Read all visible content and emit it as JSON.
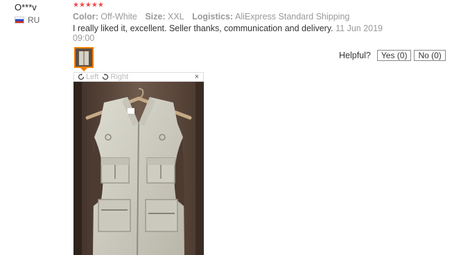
{
  "user": {
    "name": "O***v",
    "country": "RU"
  },
  "review": {
    "stars": "★★★★★",
    "color_label": "Color:",
    "color_value": "Off-White",
    "size_label": "Size:",
    "size_value": "XXL",
    "logistics_label": "Logistics:",
    "logistics_value": "AliExpress Standard Shipping",
    "text": "I really liked it, excellent. Seller thanks, communication and delivery.",
    "date": "11 Jun 2019 09:00"
  },
  "helpful": {
    "question": "Helpful?",
    "yes_label": "Yes (0)",
    "no_label": "No (0)"
  },
  "viewer": {
    "rotate_left": "Left",
    "rotate_right": "Right",
    "close": "×"
  },
  "colors": {
    "stars": "#f0484a",
    "accent": "#f07d00"
  },
  "icons": [
    "russia-flag-icon",
    "rotate-left-icon",
    "rotate-right-icon",
    "close-icon"
  ]
}
